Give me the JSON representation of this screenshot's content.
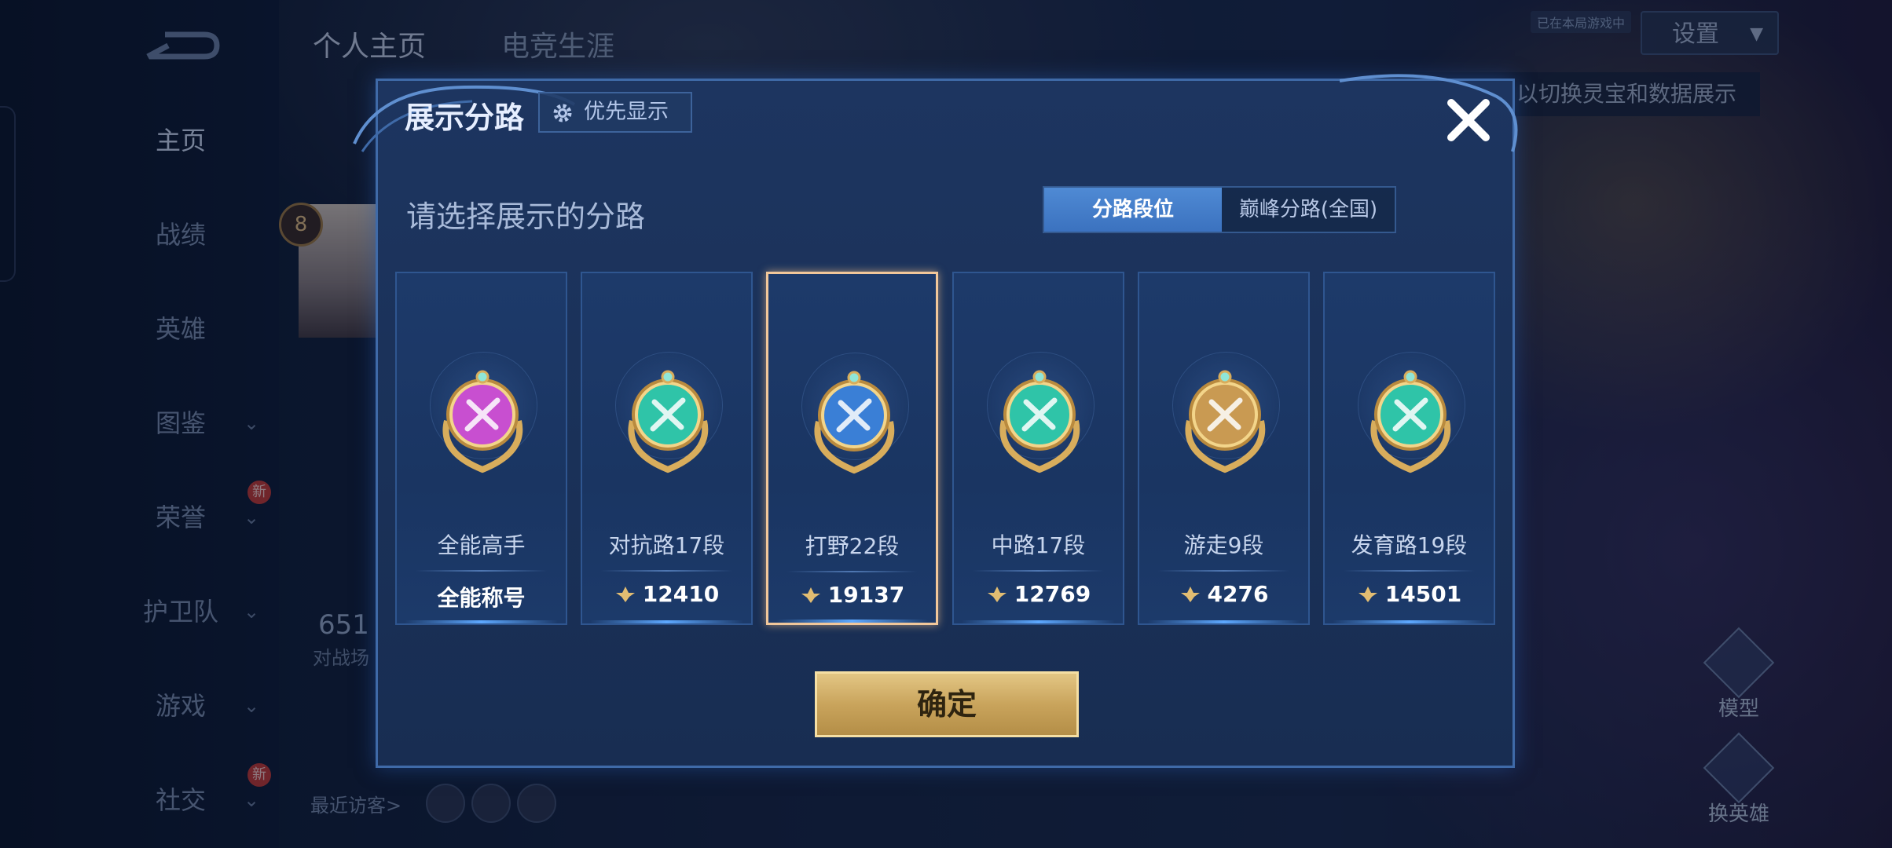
{
  "background": {
    "top_tabs": [
      "个人主页",
      "电竞生涯"
    ],
    "sidebar": [
      {
        "label": "主页",
        "active": true,
        "chevron": false,
        "badge": ""
      },
      {
        "label": "战绩",
        "active": false,
        "chevron": false,
        "badge": ""
      },
      {
        "label": "英雄",
        "active": false,
        "chevron": false,
        "badge": ""
      },
      {
        "label": "图鉴",
        "active": false,
        "chevron": true,
        "badge": ""
      },
      {
        "label": "荣誉",
        "active": false,
        "chevron": true,
        "badge": "新"
      },
      {
        "label": "护卫队",
        "active": false,
        "chevron": true,
        "badge": ""
      },
      {
        "label": "游戏",
        "active": false,
        "chevron": true,
        "badge": ""
      },
      {
        "label": "社交",
        "active": false,
        "chevron": true,
        "badge": "新"
      }
    ],
    "settings_label": "设置",
    "status_tag": "已在本局游戏中",
    "hint_text": "以切换灵宝和数据展示",
    "avatar_level": "8",
    "stat_value": "651",
    "stat_label": "对战场",
    "recent_visitors_label": "最近访客>",
    "right_buttons": [
      "模型",
      "换英雄"
    ]
  },
  "modal": {
    "title": "展示分路",
    "priority_label": "优先显示",
    "prompt": "请选择展示的分路",
    "segment": {
      "options": [
        "分路段位",
        "巅峰分路(全国)"
      ],
      "active_index": 0
    },
    "cards": [
      {
        "name": "全能高手",
        "value": "全能称号",
        "show_points_icon": false,
        "emblem": "allround-emblem-icon",
        "color": "#c84fd0",
        "selected": false
      },
      {
        "name": "对抗路17段",
        "value": "12410",
        "show_points_icon": true,
        "emblem": "clash-lane-emblem-icon",
        "color": "#2fc4a8",
        "selected": false
      },
      {
        "name": "打野22段",
        "value": "19137",
        "show_points_icon": true,
        "emblem": "jungle-emblem-icon",
        "color": "#3a7fd6",
        "selected": true
      },
      {
        "name": "中路17段",
        "value": "12769",
        "show_points_icon": true,
        "emblem": "mid-lane-emblem-icon",
        "color": "#2fc4a8",
        "selected": false
      },
      {
        "name": "游走9段",
        "value": "4276",
        "show_points_icon": true,
        "emblem": "roam-emblem-icon",
        "color": "#c99a52",
        "selected": false
      },
      {
        "name": "发育路19段",
        "value": "14501",
        "show_points_icon": true,
        "emblem": "farm-lane-emblem-icon",
        "color": "#2fc4a8",
        "selected": false
      }
    ],
    "confirm_label": "确定"
  }
}
